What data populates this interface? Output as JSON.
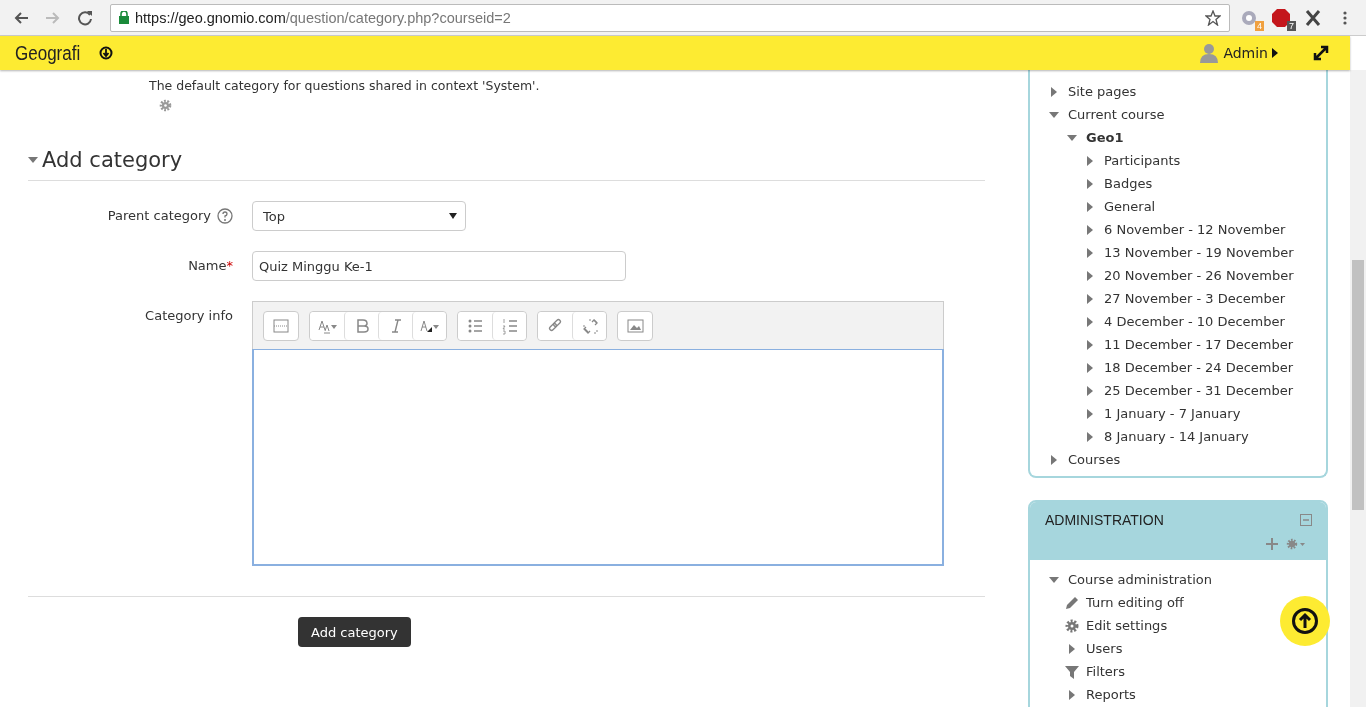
{
  "browser": {
    "url_host": "https://geo.gnomio.com",
    "url_path": "/question/category.php?courseid=2",
    "extensions": [
      {
        "kind": "puzzle",
        "badge": "4"
      },
      {
        "kind": "abp",
        "badge": "7"
      },
      {
        "kind": "x"
      }
    ]
  },
  "navbar": {
    "site_name": "Geografi",
    "user": "Admin"
  },
  "existing_category": {
    "description": "The default category for questions shared in context 'System'."
  },
  "form": {
    "section_title": "Add category",
    "expanded": true,
    "parent_label": "Parent category",
    "parent_value": "Top",
    "name_label": "Name",
    "name_required": "*",
    "name_value": "Quiz Minggu Ke-1",
    "info_label": "Category info",
    "submit": "Add category"
  },
  "navigation": {
    "items": [
      {
        "label": "Site pages",
        "kind": "branch",
        "expanded": false,
        "bold": false
      },
      {
        "label": "Current course",
        "kind": "branch",
        "expanded": true,
        "bold": false,
        "children": [
          {
            "label": "Geo1",
            "kind": "branch",
            "expanded": true,
            "bold": true,
            "children": [
              {
                "label": "Participants",
                "kind": "branch",
                "expanded": false,
                "bold": false
              },
              {
                "label": "Badges",
                "kind": "branch",
                "expanded": false,
                "bold": false
              },
              {
                "label": "General",
                "kind": "branch",
                "expanded": false,
                "bold": false
              },
              {
                "label": "6 November - 12 November",
                "kind": "branch",
                "expanded": false,
                "bold": false
              },
              {
                "label": "13 November - 19 November",
                "kind": "branch",
                "expanded": false,
                "bold": false
              },
              {
                "label": "20 November - 26 November",
                "kind": "branch",
                "expanded": false,
                "bold": false
              },
              {
                "label": "27 November - 3 December",
                "kind": "branch",
                "expanded": false,
                "bold": false
              },
              {
                "label": "4 December - 10 December",
                "kind": "branch",
                "expanded": false,
                "bold": false
              },
              {
                "label": "11 December - 17 December",
                "kind": "branch",
                "expanded": false,
                "bold": false
              },
              {
                "label": "18 December - 24 December",
                "kind": "branch",
                "expanded": false,
                "bold": false
              },
              {
                "label": "25 December - 31 December",
                "kind": "branch",
                "expanded": false,
                "bold": false
              },
              {
                "label": "1 January - 7 January",
                "kind": "branch",
                "expanded": false,
                "bold": false
              },
              {
                "label": "8 January - 14 January",
                "kind": "branch",
                "expanded": false,
                "bold": false
              }
            ]
          }
        ]
      },
      {
        "label": "Courses",
        "kind": "branch",
        "expanded": false,
        "bold": false
      }
    ]
  },
  "administration": {
    "title": "ADMINISTRATION",
    "items": [
      {
        "label": "Course administration",
        "kind": "branch",
        "expanded": true,
        "children": [
          {
            "label": "Turn editing off",
            "kind": "pencil"
          },
          {
            "label": "Edit settings",
            "kind": "gear"
          },
          {
            "label": "Users",
            "kind": "branch",
            "expanded": false
          },
          {
            "label": "Filters",
            "kind": "filter"
          },
          {
            "label": "Reports",
            "kind": "branch",
            "expanded": false
          }
        ]
      }
    ]
  }
}
